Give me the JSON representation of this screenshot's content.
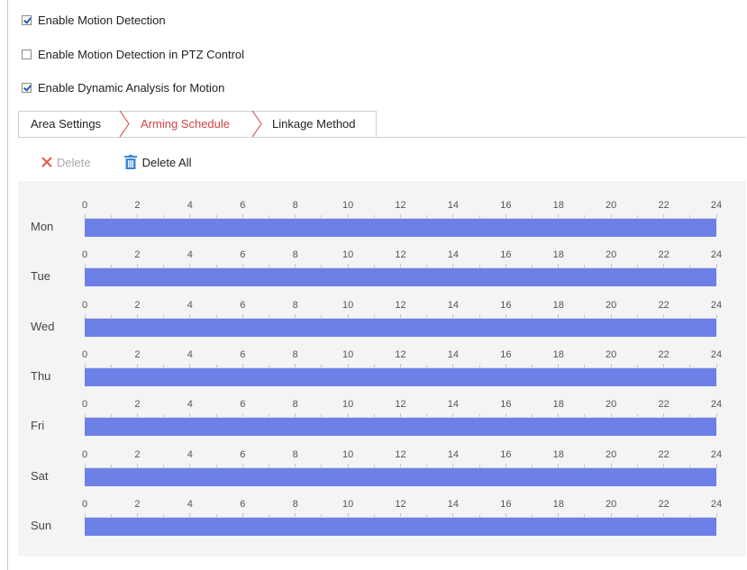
{
  "options": [
    {
      "label": "Enable Motion Detection",
      "checked": true
    },
    {
      "label": "Enable Motion Detection in PTZ Control",
      "checked": false
    },
    {
      "label": "Enable Dynamic Analysis for Motion",
      "checked": true
    }
  ],
  "tabs": [
    {
      "label": "Area Settings",
      "active": false
    },
    {
      "label": "Arming Schedule",
      "active": true
    },
    {
      "label": "Linkage Method",
      "active": false
    }
  ],
  "toolbar": {
    "delete_label": "Delete",
    "delete_all_label": "Delete All",
    "delete_icon": "close-x-icon",
    "delete_all_icon": "trash-icon"
  },
  "schedule": {
    "hours": [
      "0",
      "2",
      "4",
      "6",
      "8",
      "10",
      "12",
      "14",
      "16",
      "18",
      "20",
      "22",
      "24"
    ],
    "days": [
      {
        "label": "Mon",
        "segments": [
          [
            0,
            24
          ]
        ]
      },
      {
        "label": "Tue",
        "segments": [
          [
            0,
            24
          ]
        ]
      },
      {
        "label": "Wed",
        "segments": [
          [
            0,
            24
          ]
        ]
      },
      {
        "label": "Thu",
        "segments": [
          [
            0,
            24
          ]
        ]
      },
      {
        "label": "Fri",
        "segments": [
          [
            0,
            24
          ]
        ]
      },
      {
        "label": "Sat",
        "segments": [
          [
            0,
            24
          ]
        ]
      },
      {
        "label": "Sun",
        "segments": [
          [
            0,
            24
          ]
        ]
      }
    ]
  },
  "colors": {
    "bar": "#6c80e7",
    "active_tab": "#d24242",
    "delete_icon": "#e05a4a",
    "trash_icon": "#3a8ad8"
  }
}
